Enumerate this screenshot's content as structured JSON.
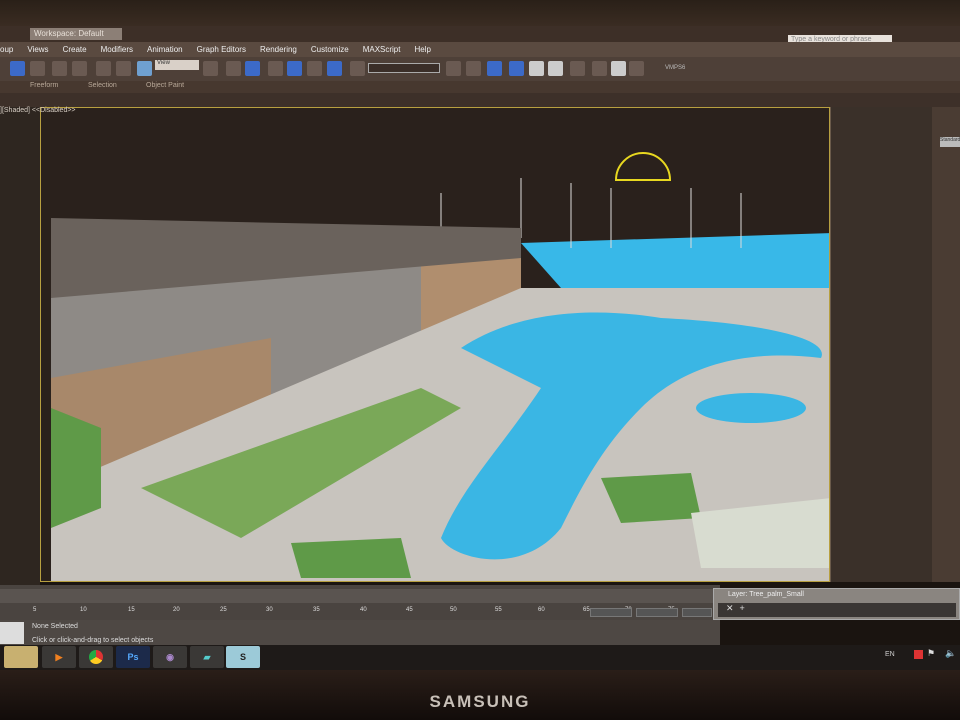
{
  "title_bar": {
    "workspace": "Workspace: Default",
    "search_placeholder": "Type a keyword or phrase"
  },
  "menu": [
    "oup",
    "Views",
    "Create",
    "Modifiers",
    "Animation",
    "Graph Editors",
    "Rendering",
    "Customize",
    "MAXScript",
    "Help"
  ],
  "toolbar": {
    "ref_coord": "View",
    "label": "VMPS6"
  },
  "ribbon": {
    "tabs": [
      "Freeform",
      "Selection",
      "Object Paint"
    ]
  },
  "viewport": {
    "label": "][Shaded]",
    "mode": "<<Disabled>>"
  },
  "command_panel": {
    "dropdown": "Standard"
  },
  "timeline": {
    "ticks": [
      "5",
      "10",
      "15",
      "20",
      "25",
      "30",
      "35",
      "40",
      "45",
      "50",
      "55",
      "60",
      "65",
      "70",
      "75"
    ]
  },
  "status": {
    "selection": "None Selected",
    "prompt": "Click or click-and-drag to select objects"
  },
  "layer_window": {
    "title": "Layer: Tree_palm_Small"
  },
  "tray": {
    "lang": "EN"
  },
  "taskbar": [
    "explorer",
    "media-player",
    "chrome",
    "Ps",
    "viber",
    "app",
    "3ds-max"
  ],
  "monitor": {
    "brand": "SAMSUNG"
  }
}
